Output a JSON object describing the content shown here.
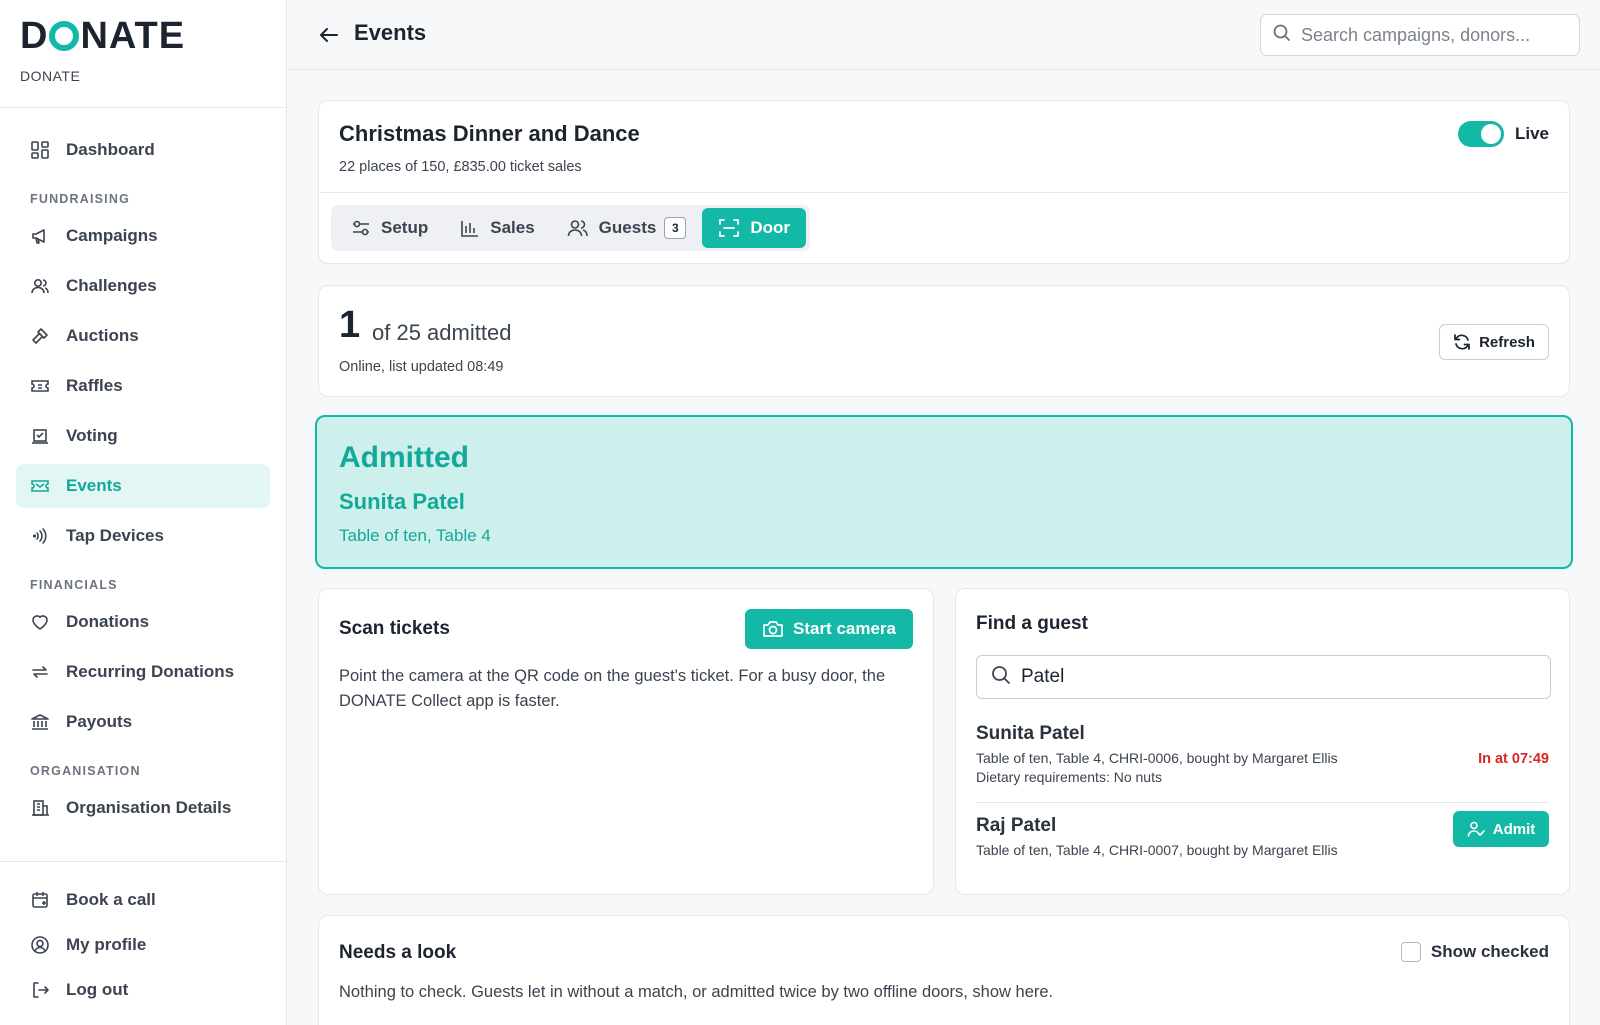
{
  "brand": {
    "logo": "DONATE",
    "subtitle": "DONATE"
  },
  "sidebar": {
    "top_items": [
      {
        "label": "Dashboard",
        "icon": "dashboard-icon"
      }
    ],
    "sections": [
      {
        "label": "FUNDRAISING",
        "items": [
          {
            "label": "Campaigns",
            "icon": "megaphone-icon"
          },
          {
            "label": "Challenges",
            "icon": "users-icon"
          },
          {
            "label": "Auctions",
            "icon": "gavel-icon"
          },
          {
            "label": "Raffles",
            "icon": "ticket-icon"
          },
          {
            "label": "Voting",
            "icon": "ballot-icon"
          },
          {
            "label": "Events",
            "icon": "event-ticket-icon",
            "active": true
          },
          {
            "label": "Tap Devices",
            "icon": "contactless-icon"
          }
        ]
      },
      {
        "label": "FINANCIALS",
        "items": [
          {
            "label": "Donations",
            "icon": "heart-icon"
          },
          {
            "label": "Recurring Donations",
            "icon": "repeat-icon"
          },
          {
            "label": "Payouts",
            "icon": "bank-icon"
          }
        ]
      },
      {
        "label": "ORGANISATION",
        "items": [
          {
            "label": "Organisation Details",
            "icon": "building-icon"
          }
        ]
      }
    ],
    "bottom_items": [
      {
        "label": "Book a call",
        "icon": "calendar-icon"
      },
      {
        "label": "My profile",
        "icon": "user-circle-icon"
      },
      {
        "label": "Log out",
        "icon": "logout-icon"
      }
    ]
  },
  "header": {
    "title": "Events",
    "search_placeholder": "Search campaigns, donors..."
  },
  "event": {
    "title": "Christmas Dinner and Dance",
    "subtitle": "22 places of 150, £835.00 ticket sales",
    "live_label": "Live",
    "tabs": [
      {
        "label": "Setup",
        "icon": "sliders-icon"
      },
      {
        "label": "Sales",
        "icon": "bar-chart-icon"
      },
      {
        "label": "Guests",
        "icon": "guests-icon",
        "count": "3"
      },
      {
        "label": "Door",
        "icon": "scan-icon",
        "active": true
      }
    ]
  },
  "admitted": {
    "count": "1",
    "of_label": "of 25 admitted",
    "status": "Online, list updated 08:49",
    "refresh_label": "Refresh"
  },
  "status": {
    "title": "Admitted",
    "name": "Sunita Patel",
    "table": "Table of ten, Table 4"
  },
  "scan": {
    "title": "Scan tickets",
    "camera_label": "Start camera",
    "text": "Point the camera at the QR code on the guest's ticket. For a busy door, the DONATE Collect app is faster."
  },
  "find": {
    "title": "Find a guest",
    "query": "Patel",
    "results": [
      {
        "name": "Sunita Patel",
        "line1": "Table of ten, Table 4, CHRI-0006, bought by Margaret Ellis",
        "line2": "Dietary requirements: No nuts",
        "status": "In at 07:49"
      },
      {
        "name": "Raj Patel",
        "line1": "Table of ten, Table 4, CHRI-0007, bought by Margaret Ellis",
        "action": "Admit"
      }
    ]
  },
  "look": {
    "title": "Needs a look",
    "show_checked": "Show checked",
    "text": "Nothing to check. Guests let in without a match, or admitted twice by two offline doors, show here."
  },
  "colors": {
    "accent": "#14b8a6",
    "accent_light": "#cdf0ec",
    "danger": "#dc2626"
  }
}
